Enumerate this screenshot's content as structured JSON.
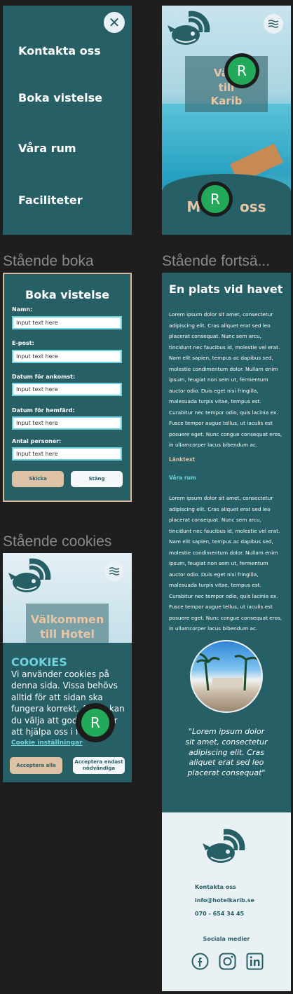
{
  "labels": {
    "booking_frame": "Stående boka",
    "continued_frame": "Stående fortsä...",
    "cookies_frame": "Stående cookies"
  },
  "menu": {
    "close_icon": "close-icon",
    "items": [
      "Kontakta oss",
      "Boka vistelse",
      "Våra rum",
      "Faciliteter"
    ]
  },
  "hero": {
    "title_lines": [
      "Välk",
      "till",
      "Karib"
    ],
    "bottom_text": "M        oss",
    "badge_letter": "R"
  },
  "booking": {
    "title": "Boka vistelse",
    "fields": [
      {
        "label": "Namn:",
        "placeholder": "Input text here"
      },
      {
        "label": "E-post:",
        "placeholder": "Input text here"
      },
      {
        "label": "Datum för ankomst:",
        "placeholder": "Input text here"
      },
      {
        "label": "Datum för hemfärd:",
        "placeholder": "Input text here"
      },
      {
        "label": "Antal personer:",
        "placeholder": "Input text here"
      }
    ],
    "send_label": "Skicka",
    "close_label": "Stäng"
  },
  "cookies": {
    "hero_title_lines": [
      "Välkommen",
      "till Hotel"
    ],
    "title": "COOKIES",
    "text": "Vi använder cookies på denna sida. Vissa behövs alltid för att sidan ska fungera korrekt. Andra kan du välja att godkänna för att hjälpa oss i fram",
    "link": "Cookie inställningar",
    "accept_all": "Acceptera alla",
    "accept_necessary": "Acceptera endast nödvändiga",
    "badge_letter": "R"
  },
  "continued": {
    "heading": "En plats vid havet",
    "paragraph1": "Lorem ipsum dolor sit amet, consectetur adipiscing elit. Cras aliquet erat sed leo placerat consequat. Nunc sem arcu, tincidunt nec faucibus id, molestie vel erat. Nam elit sapien, tempus ac dapibus sed, molestie condimentum dolor. Nullam enim ipsum, feugiat non sem ut, fermentum auctor odio. Duis eget nisi fringilla, malesuada turpis vitae, tempus est. Curabitur nec tempor odio, quis lacinia ex. Fusce tempor augue tellus, ut iaculis est posuere eget. Nunc congue consequat eros, in ullamcorper lacus bibendum ac.",
    "link_text": "Länktext",
    "rooms_title": "Våra rum",
    "paragraph2": "Lorem ipsum dolor sit amet, consectetur adipiscing elit. Cras aliquet erat sed leo placerat consequat. Nunc sem arcu, tincidunt nec faucibus id, molestie vel erat. Nam elit sapien, tempus ac dapibus sed, molestie condimentum dolor. Nullam enim ipsum, feugiat non sem ut, fermentum auctor odio. Duis eget nisi fringilla, malesuada turpis vitae, tempus est. Curabitur nec tempor odio, quis lacinia ex. Fusce tempor augue tellus, ut iaculis est posuere eget. Nunc congue consequat eros, in ullamcorper lacus bibendum ac.",
    "quote": "\"Lorem ipsum dolor sit amet, consectetur adipiscing elit. Cras aliquet erat sed leo placerat consequat\"",
    "footer": {
      "contact": "Kontakta oss",
      "email": "info@hotelkarib.se",
      "phone": "070 - 654 34 45",
      "social_title": "Sociala medier",
      "social_icons": [
        "facebook-icon",
        "instagram-icon",
        "linkedin-icon"
      ]
    }
  },
  "colors": {
    "teal": "#275f66",
    "sand": "#dec2a6",
    "aqua": "#6fd3dd",
    "light": "#e9f1f5",
    "badge_green": "#23a95a"
  }
}
